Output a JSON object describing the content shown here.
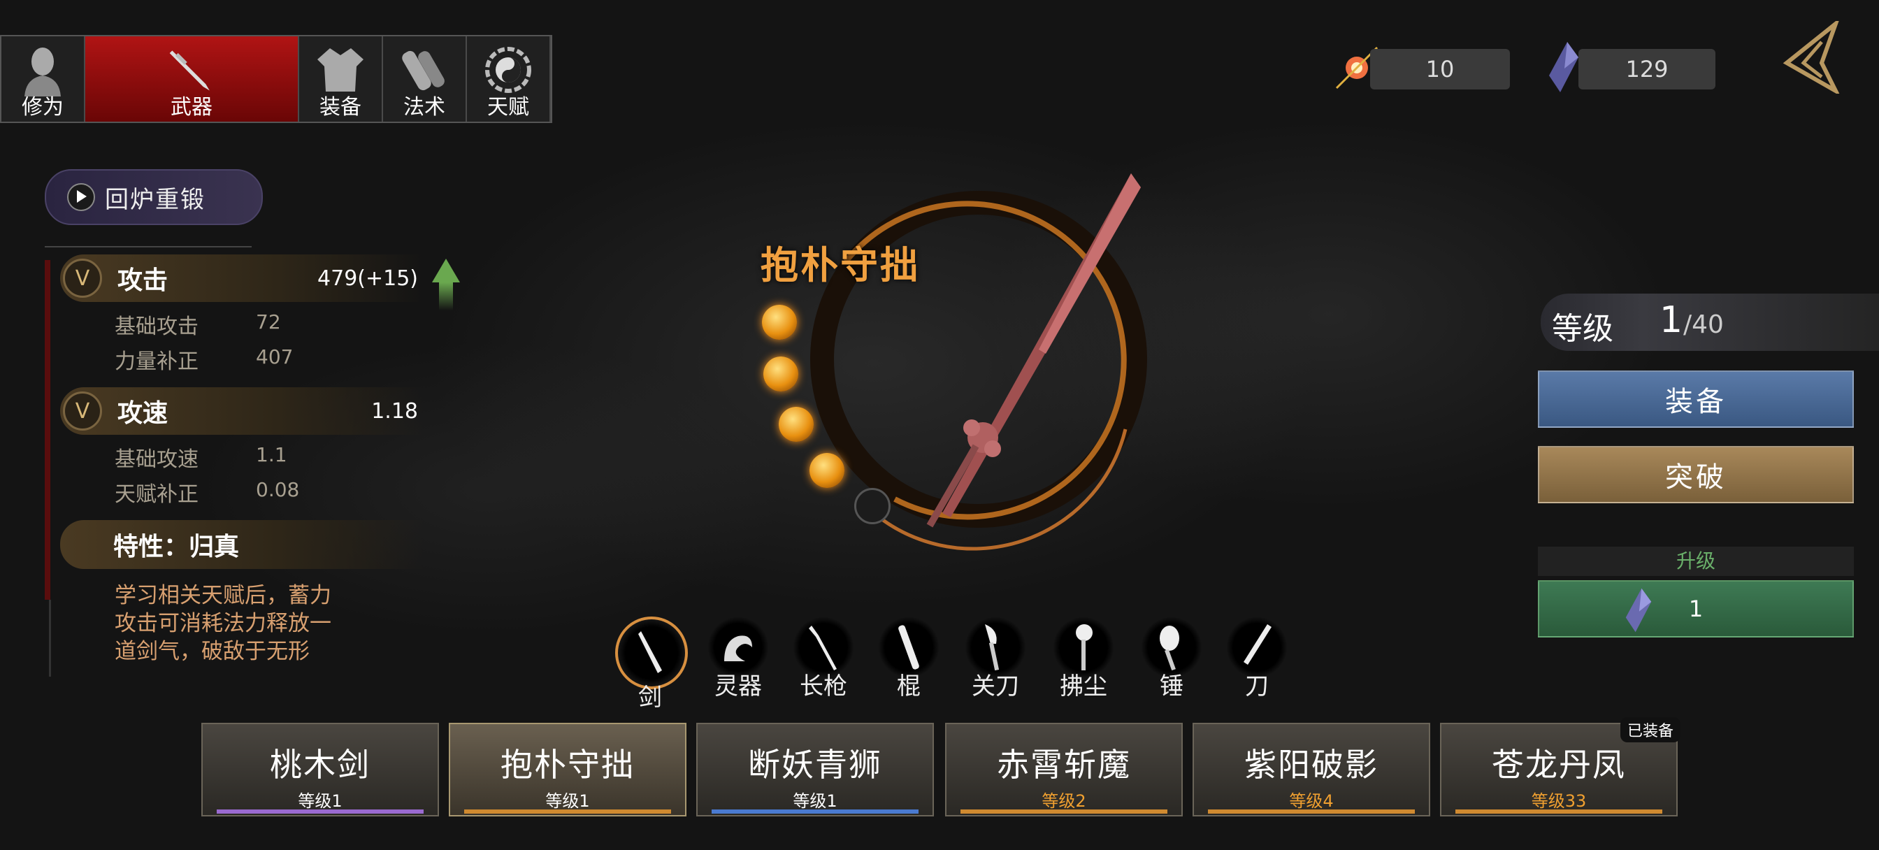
{
  "tabs": [
    {
      "label": "修为",
      "icon": "monk-icon"
    },
    {
      "label": "武器",
      "icon": "sword-icon",
      "active": true
    },
    {
      "label": "装备",
      "icon": "robe-icon"
    },
    {
      "label": "法术",
      "icon": "gourd-icon"
    },
    {
      "label": "天赋",
      "icon": "bagua-icon"
    }
  ],
  "currency": {
    "essence": "10",
    "crystal": "129"
  },
  "reforge_label": "回炉重锻",
  "stats": {
    "attack": {
      "label": "攻击",
      "value": "479(+15)",
      "subs": [
        {
          "label": "基础攻击",
          "value": "72"
        },
        {
          "label": "力量补正",
          "value": "407"
        }
      ]
    },
    "speed": {
      "label": "攻速",
      "value": "1.18",
      "subs": [
        {
          "label": "基础攻速",
          "value": "1.1"
        },
        {
          "label": "天赋补正",
          "value": "0.08"
        }
      ]
    },
    "trait": {
      "label": "特性：归真",
      "desc": "学习相关天赋后，蓄力攻击可消耗法力释放一道剑气，破敌于无形"
    }
  },
  "weapon_name": "抱朴守拙",
  "weapon_types": [
    "剑",
    "灵器",
    "长枪",
    "棍",
    "关刀",
    "拂尘",
    "锤",
    "刀"
  ],
  "level": {
    "label": "等级",
    "current": "1",
    "max": "/40"
  },
  "buttons": {
    "equip": "装备",
    "breakthrough": "突破",
    "upgrade_label": "升级",
    "upgrade_cost": "1"
  },
  "weapons": [
    {
      "name": "桃木剑",
      "level": "等级1",
      "bar": "#9a6ad0"
    },
    {
      "name": "抱朴守拙",
      "level": "等级1",
      "bar": "#d08a30"
    },
    {
      "name": "断妖青狮",
      "level": "等级1",
      "bar": "#4a7ad0"
    },
    {
      "name": "赤霄斩魔",
      "level": "等级2",
      "bar": "#d08a30",
      "lvcolor": "#f0a030"
    },
    {
      "name": "紫阳破影",
      "level": "等级4",
      "bar": "#d08a30",
      "lvcolor": "#f0a030"
    },
    {
      "name": "苍龙丹凤",
      "level": "等级33",
      "bar": "#d08a30",
      "lvcolor": "#f0a030"
    }
  ],
  "equipped_tag": "已装备"
}
